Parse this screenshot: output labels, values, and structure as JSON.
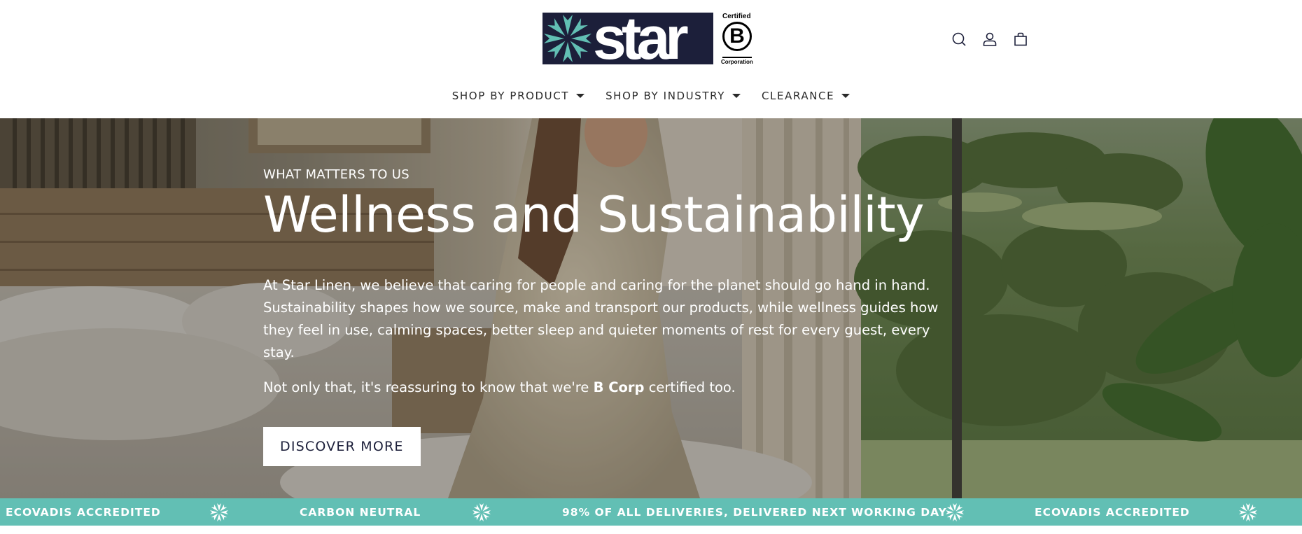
{
  "brand": {
    "logo_text": "star",
    "bcorp_top": "Certified",
    "bcorp_letter": "B",
    "bcorp_bottom": "Corporation",
    "colors": {
      "navy": "#1c1f3a",
      "teal": "#62bfb4"
    }
  },
  "header_icons": [
    "search-icon",
    "account-icon",
    "cart-icon"
  ],
  "nav": {
    "items": [
      {
        "label": "SHOP BY PRODUCT"
      },
      {
        "label": "SHOP BY INDUSTRY"
      },
      {
        "label": "CLEARANCE"
      }
    ]
  },
  "hero": {
    "eyebrow": "WHAT MATTERS TO US",
    "headline": "Wellness and Sustainability",
    "paragraph": "At Star Linen, we believe that caring for people and caring for the planet should go hand in hand. Sustainability shapes how we source, make and transport our products, while wellness guides how they feel in use, calming spaces, better sleep and quieter moments of rest for every guest, every stay.",
    "paragraph2_before": "Not only that, it's reassuring to know that we're ",
    "paragraph2_bold": "B Corp",
    "paragraph2_after": " certified too.",
    "cta": "DISCOVER MORE"
  },
  "ticker": {
    "items": [
      "ECOVADIS ACCREDITED",
      "CARBON NEUTRAL",
      "98% OF ALL DELIVERIES, DELIVERED NEXT WORKING DAY",
      "ECOVADIS ACCREDITED"
    ]
  }
}
